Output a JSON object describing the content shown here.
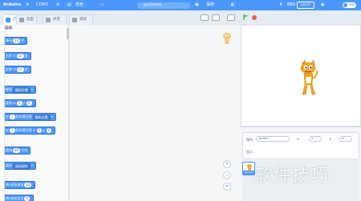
{
  "menubar": {
    "brand": "Arduino",
    "port": "COM3",
    "sprite_label": "角色",
    "project_name": "pen1blink",
    "save_label": "保存",
    "help_label": "BBS",
    "login_label": "Learn",
    "mode_label": "Web",
    "accent": "#4c97ff"
  },
  "tabs": [
    {
      "label": "代码"
    },
    {
      "label": "造型"
    },
    {
      "label": "声音"
    },
    {
      "label": "调试"
    }
  ],
  "palette": {
    "category_title": "运动",
    "blocks": {
      "move": {
        "pre": "移动",
        "val": "10",
        "post": "步"
      },
      "turn_right": {
        "pre": "右转",
        "icon": "↻",
        "val": "15",
        "post": "度"
      },
      "turn_left": {
        "pre": "左转",
        "icon": "↺",
        "val": "15",
        "post": "度"
      },
      "goto": {
        "pre": "移到",
        "dd": "随机位置"
      },
      "goto_xy": {
        "pre": "移到 x:",
        "x": "0",
        "mid": "y:",
        "y": "0"
      },
      "glide": {
        "pre": "在",
        "val": "1",
        "mid": "秒内滑行到",
        "dd": "随机位置"
      },
      "glide_xy": {
        "pre": "在",
        "val": "1",
        "mid": "秒内滑行到 x:",
        "x": "0",
        "mid2": "y:",
        "y": "0"
      },
      "point_dir": {
        "pre": "面向",
        "val": "90",
        "post": "方向"
      },
      "point_towards": {
        "pre": "面向",
        "dd": "鼠标指针"
      },
      "change_x": {
        "pre": "将x坐标增加",
        "val": "10"
      },
      "set_x": {
        "pre": "将x坐标设为",
        "val": "0"
      }
    }
  },
  "workspace": {
    "zoom_in": "+",
    "zoom_out": "−",
    "zoom_reset": "="
  },
  "sprite_info": {
    "sprite_label": "角色",
    "sprite_name": "Sprite1",
    "x_label": "↔",
    "x_value": "0",
    "y_label": "↕",
    "y_value": "0",
    "show_label": "显示",
    "size_label": "大小",
    "direction_label": "方向"
  },
  "sprite_list": {
    "cards": [
      {
        "name": "Sprite1"
      }
    ]
  },
  "watermark": "软件技巧"
}
